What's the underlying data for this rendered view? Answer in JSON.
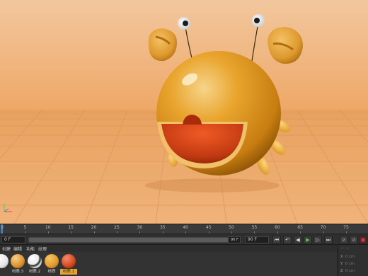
{
  "timeline": {
    "ticks": [
      "0",
      "5",
      "10",
      "15",
      "20",
      "25",
      "30",
      "35",
      "40",
      "45",
      "50",
      "55",
      "60",
      "65",
      "70",
      "75"
    ],
    "current_frame": "0 F",
    "range_end_left": "90 F",
    "range_end_right": "90 F"
  },
  "transport": {
    "buttons": [
      "⏮",
      "↶",
      "◀",
      "▶",
      "▷",
      "⏭"
    ],
    "key_button": "●"
  },
  "material_manager": {
    "menu": [
      "创建",
      "编辑",
      "功能",
      "纹理"
    ],
    "materials": [
      {
        "label": "材质.3",
        "color": "#f2f2f2"
      },
      {
        "label": "材质.2",
        "color": "#f6f6f6"
      },
      {
        "label": "材质",
        "color": "#e09a2a"
      },
      {
        "label": "材质.1",
        "color": "#d3481d",
        "selected": true
      }
    ]
  },
  "coordinates": {
    "rows": [
      {
        "axis": "X",
        "value": "0 cm"
      },
      {
        "axis": "Y",
        "value": "0 cm"
      },
      {
        "axis": "Z",
        "value": "0 cm"
      }
    ]
  },
  "colors": {
    "background": "#f0b073",
    "floor": "#e6a060",
    "shell": "#e39a22",
    "mouth": "#c63512"
  }
}
